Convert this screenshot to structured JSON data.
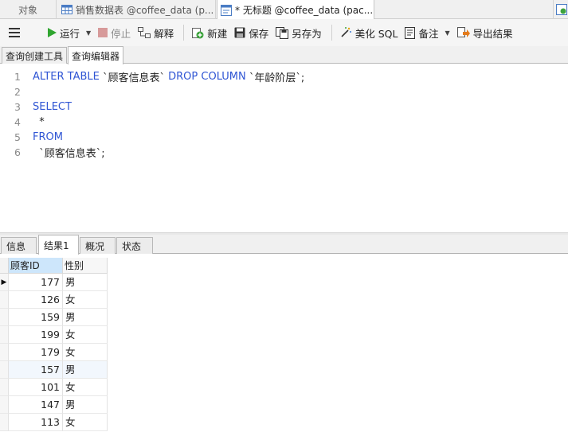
{
  "doc_tabs": [
    {
      "label": "对象"
    },
    {
      "label": "销售数据表 @coffee_data (p..."
    },
    {
      "label": "* 无标题 @coffee_data (pac..."
    },
    {
      "label": ""
    }
  ],
  "toolbar": {
    "run": "运行",
    "stop": "停止",
    "explain": "解释",
    "new": "新建",
    "save": "保存",
    "save_as": "另存为",
    "beautify": "美化 SQL",
    "note": "备注",
    "export": "导出结果"
  },
  "mode_tabs": [
    "查询创建工具",
    "查询编辑器"
  ],
  "editor": {
    "line_numbers": [
      "1",
      "2",
      "3",
      "4",
      "5",
      "6"
    ],
    "line1": {
      "kw1": "ALTER TABLE",
      "t1": " `顾客信息表` ",
      "kw2": "DROP COLUMN",
      "t2": " `年龄阶层`;"
    },
    "line3": {
      "kw": "SELECT"
    },
    "line4": {
      "t": "  *"
    },
    "line5": {
      "kw": "FROM"
    },
    "line6": {
      "t": "  `顾客信息表`;"
    }
  },
  "result_tabs": [
    "信息",
    "结果1",
    "概况",
    "状态"
  ],
  "grid": {
    "columns": [
      "顾客ID",
      "性别"
    ],
    "rows": [
      {
        "id": "177",
        "sex": "男"
      },
      {
        "id": "126",
        "sex": "女"
      },
      {
        "id": "159",
        "sex": "男"
      },
      {
        "id": "199",
        "sex": "女"
      },
      {
        "id": "179",
        "sex": "女"
      },
      {
        "id": "157",
        "sex": "男"
      },
      {
        "id": "101",
        "sex": "女"
      },
      {
        "id": "147",
        "sex": "男"
      },
      {
        "id": "113",
        "sex": "女"
      }
    ]
  }
}
